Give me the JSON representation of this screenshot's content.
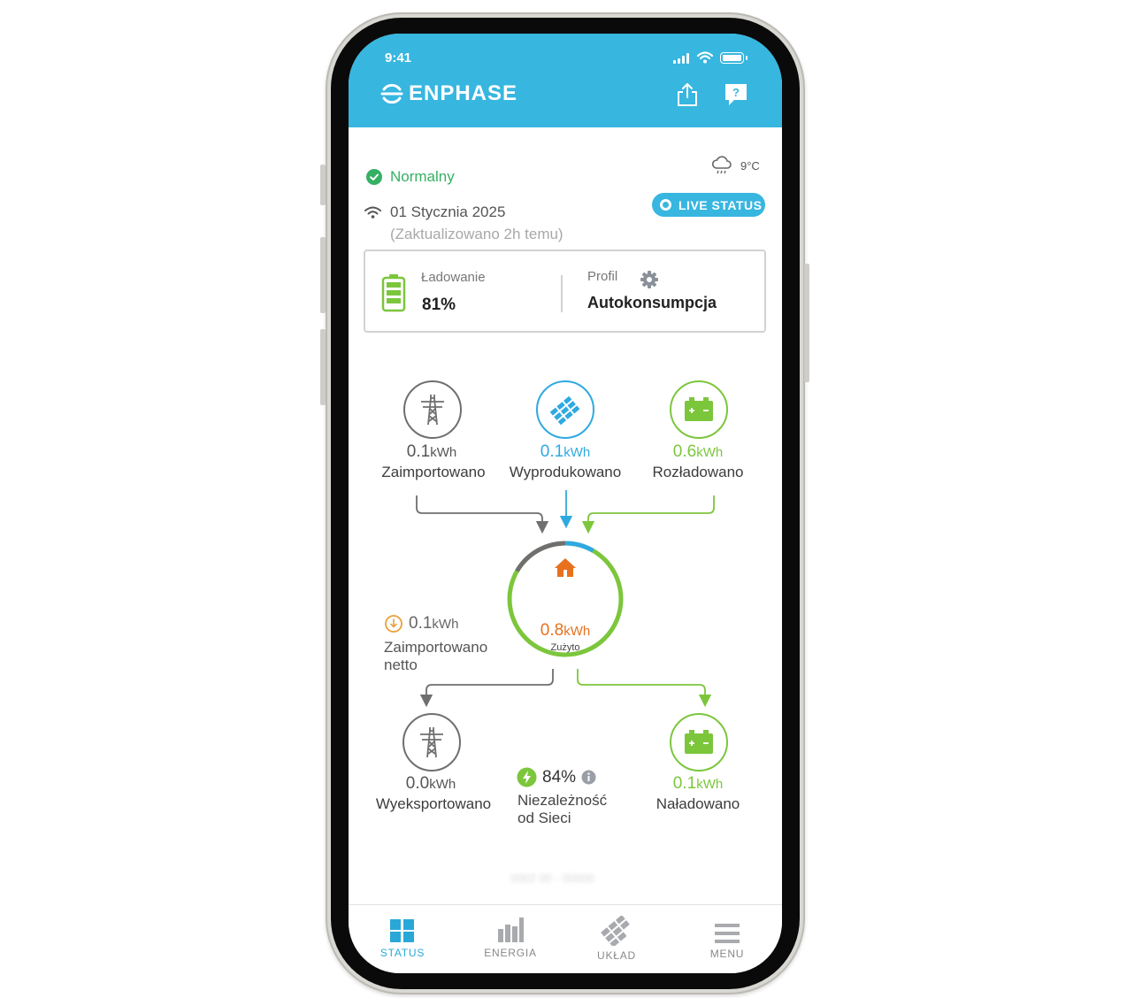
{
  "status_bar": {
    "time": "9:41"
  },
  "header": {
    "brand": "ENPHASE",
    "share_icon": "share-icon",
    "help_icon": "help-icon"
  },
  "status": {
    "state": "Normalny",
    "date": "01 Stycznia 2025",
    "updated": "(Zaktualizowano 2h temu)",
    "temperature": "9°C",
    "live_status": "LIVE STATUS"
  },
  "battery_card": {
    "charging_label": "Ładowanie",
    "charging_value": "81%",
    "charge_level": 0.81,
    "profile_label": "Profil",
    "profile_value": "Autokonsumpcja"
  },
  "flows": {
    "unit": "kWh",
    "imported": {
      "value": "0.1",
      "label": "Zaimportowano"
    },
    "produced": {
      "value": "0.1",
      "label": "Wyprodukowano"
    },
    "discharged": {
      "value": "0.6",
      "label": "Rozładowano"
    },
    "consumed": {
      "value": "0.8",
      "label": "Zużyto"
    },
    "net_imported": {
      "value": "0.1",
      "label_line1": "Zaimportowano",
      "label_line2": "netto"
    },
    "exported": {
      "value": "0.0",
      "label": "Wyeksportowano"
    },
    "independence": {
      "value": "84%",
      "label_line1": "Niezależność",
      "label_line2": "od Sieci"
    },
    "charged": {
      "value": "0.1",
      "label": "Naładowano"
    }
  },
  "footer_blur": "0002 00 - 00000",
  "tabs": [
    {
      "label": "STATUS",
      "active": true
    },
    {
      "label": "ENERGIA",
      "active": false
    },
    {
      "label": "UKŁAD",
      "active": false
    },
    {
      "label": "MENU",
      "active": false
    }
  ],
  "colors": {
    "brand_blue": "#37b6e0",
    "ok_green": "#35b063",
    "battery_green": "#7cc63c",
    "solar_blue": "#2fa9e0",
    "consumption_orange": "#e8711e",
    "grid_gray": "#6f6f6f"
  }
}
